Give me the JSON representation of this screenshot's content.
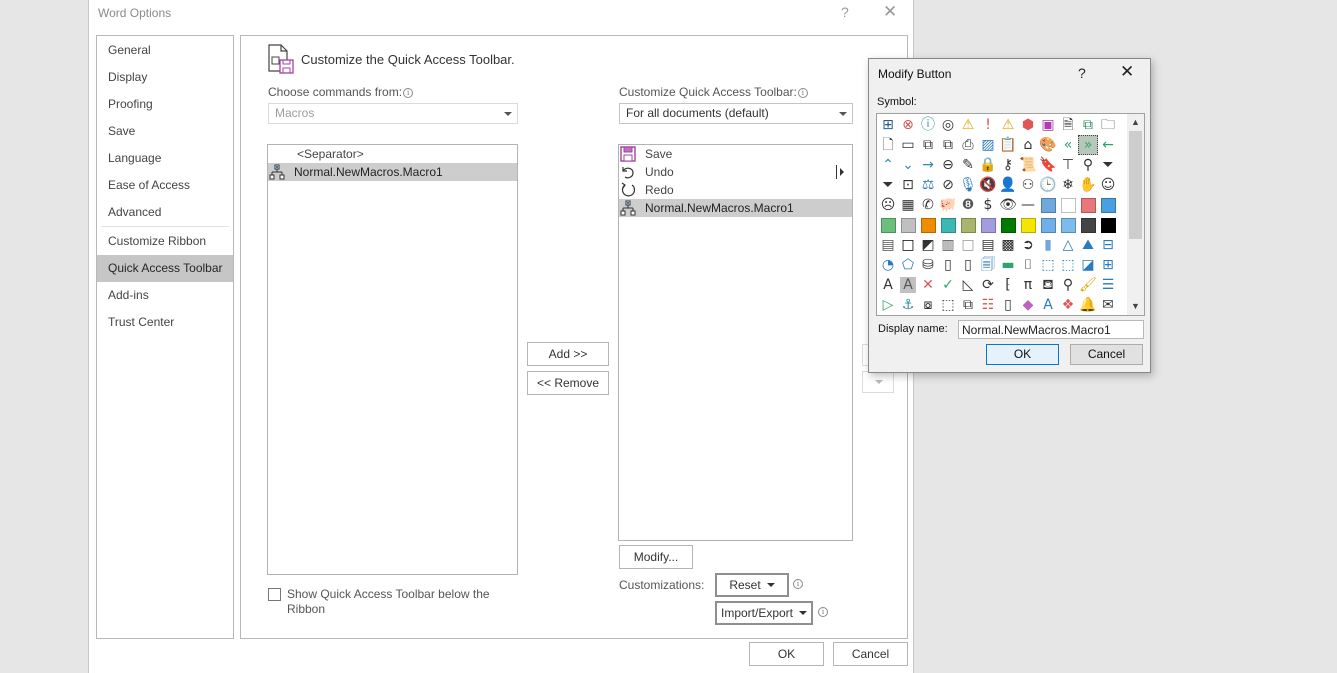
{
  "window": {
    "title": "Word Options",
    "help_label": "?",
    "close_label": "✕"
  },
  "nav": {
    "items": [
      {
        "label": "General"
      },
      {
        "label": "Display"
      },
      {
        "label": "Proofing"
      },
      {
        "label": "Save"
      },
      {
        "label": "Language"
      },
      {
        "label": "Ease of Access"
      },
      {
        "label": "Advanced"
      },
      {
        "label": "Customize Ribbon"
      },
      {
        "label": "Quick Access Toolbar",
        "active": true
      },
      {
        "label": "Add-ins"
      },
      {
        "label": "Trust Center"
      }
    ]
  },
  "main": {
    "heading": "Customize the Quick Access Toolbar.",
    "choose_label": "Choose commands from:",
    "choose_value": "Macros",
    "commands_list": [
      {
        "label": "<Separator>",
        "icon": "separator"
      },
      {
        "label": "Normal.NewMacros.Macro1",
        "icon": "macro-icon",
        "selected": true
      }
    ],
    "customize_label": "Customize Quick Access Toolbar:",
    "customize_value": "For all documents (default)",
    "toolbar_list": [
      {
        "label": "Save",
        "icon": "save-icon"
      },
      {
        "label": "Undo",
        "icon": "undo-icon"
      },
      {
        "label": "Redo",
        "icon": "redo-icon"
      },
      {
        "label": "Normal.NewMacros.Macro1",
        "icon": "macro-icon",
        "selected": true
      }
    ],
    "add_button": "Add >>",
    "remove_button": "<< Remove",
    "modify_button": "Modify...",
    "customizations_label": "Customizations:",
    "reset_button": "Reset",
    "import_export_button": "Import/Export",
    "show_below_ribbon_label": "Show Quick Access Toolbar below the Ribbon",
    "show_below_ribbon_checked": false,
    "ok_button": "OK",
    "cancel_button": "Cancel"
  },
  "modify_dialog": {
    "title": "Modify Button",
    "help_label": "?",
    "close_label": "✕",
    "symbol_label": "Symbol:",
    "display_name_label": "Display name:",
    "display_name_value": "Normal.NewMacros.Macro1",
    "ok_button": "OK",
    "cancel_button": "Cancel",
    "scroll_up": "▲",
    "scroll_down": "▼",
    "symbols": [
      {
        "name": "org-chart-icon",
        "glyph": "⊞",
        "color": "#2a5c8a"
      },
      {
        "name": "error-circle-icon",
        "glyph": "⊗",
        "color": "#d9534f"
      },
      {
        "name": "info-circle-icon",
        "glyph": "ⓘ",
        "color": "#2e8fa3"
      },
      {
        "name": "target-icon",
        "glyph": "◎",
        "color": "#333333"
      },
      {
        "name": "warning-icon",
        "glyph": "⚠",
        "color": "#e0a400"
      },
      {
        "name": "exclamation-icon",
        "glyph": "!",
        "color": "#d9534f"
      },
      {
        "name": "warning-alt-icon",
        "glyph": "⚠",
        "color": "#e0a400"
      },
      {
        "name": "shield-icon",
        "glyph": "⬢",
        "color": "#e05555"
      },
      {
        "name": "save-icon",
        "glyph": "▣",
        "color": "#b03cb0"
      },
      {
        "name": "document-arrow-icon",
        "glyph": "🗎",
        "color": "#333333"
      },
      {
        "name": "save-sync-icon",
        "glyph": "⧉",
        "color": "#2a8a5a"
      },
      {
        "name": "folder-icon",
        "glyph": "🗀",
        "color": "#333333"
      },
      {
        "name": "document-icon",
        "glyph": "🗋",
        "color": "#333333"
      },
      {
        "name": "folder-open-icon",
        "glyph": "▭",
        "color": "#333333"
      },
      {
        "name": "copy-icon",
        "glyph": "⧉",
        "color": "#333333"
      },
      {
        "name": "mail-merge-icon",
        "glyph": "⧉",
        "color": "#333333"
      },
      {
        "name": "printer-icon",
        "glyph": "⎙",
        "color": "#333333"
      },
      {
        "name": "picture-icon",
        "glyph": "▨",
        "color": "#2a7abf"
      },
      {
        "name": "clipboard-icon",
        "glyph": "📋",
        "color": "#333333"
      },
      {
        "name": "home-icon",
        "glyph": "⌂",
        "color": "#333333"
      },
      {
        "name": "palette-icon",
        "glyph": "🎨",
        "color": "#333333"
      },
      {
        "name": "double-left-arrow-icon",
        "glyph": "«",
        "color": "#2fa36b"
      },
      {
        "name": "double-right-arrow-icon",
        "glyph": "»",
        "color": "#2fa36b",
        "selected": true
      },
      {
        "name": "left-arrow-icon",
        "glyph": "←",
        "color": "#2fa36b"
      },
      {
        "name": "chevron-up-icon",
        "glyph": "⌃",
        "color": "#2e8fa3"
      },
      {
        "name": "chevron-down-icon",
        "glyph": "⌄",
        "color": "#2e8fa3"
      },
      {
        "name": "right-arrow-icon",
        "glyph": "→",
        "color": "#2e8fa3"
      },
      {
        "name": "back-circle-icon",
        "glyph": "⊖",
        "color": "#333333"
      },
      {
        "name": "pin-icon",
        "glyph": "✎",
        "color": "#333333"
      },
      {
        "name": "lock-icon",
        "glyph": "🔒",
        "color": "#333333"
      },
      {
        "name": "key-icon",
        "glyph": "⚷",
        "color": "#333333"
      },
      {
        "name": "scroll-icon",
        "glyph": "📜",
        "color": "#333333"
      },
      {
        "name": "bookmark-icon",
        "glyph": "🔖",
        "color": "#333333"
      },
      {
        "name": "presentation-icon",
        "glyph": "⊤",
        "color": "#333333"
      },
      {
        "name": "search-icon",
        "glyph": "⚲",
        "color": "#333333"
      },
      {
        "name": "filter-icon",
        "glyph": "⏷",
        "color": "#333333"
      },
      {
        "name": "funnel-icon",
        "glyph": "⏷",
        "color": "#333333"
      },
      {
        "name": "contact-card-icon",
        "glyph": "⊡",
        "color": "#333333"
      },
      {
        "name": "scales-icon",
        "glyph": "⚖",
        "color": "#2a7abf"
      },
      {
        "name": "no-entry-icon",
        "glyph": "⊘",
        "color": "#333333"
      },
      {
        "name": "microphone-icon",
        "glyph": "🎙",
        "color": "#2a7abf"
      },
      {
        "name": "mute-icon",
        "glyph": "🔇",
        "color": "#333333"
      },
      {
        "name": "user-filled-icon",
        "glyph": "👤",
        "color": "#333333"
      },
      {
        "name": "user-outline-icon",
        "glyph": "⚇",
        "color": "#333333"
      },
      {
        "name": "clock-icon",
        "glyph": "🕒",
        "color": "#333333"
      },
      {
        "name": "snowflake-icon",
        "glyph": "❄",
        "color": "#333333"
      },
      {
        "name": "hand-icon",
        "glyph": "✋",
        "color": "#333333"
      },
      {
        "name": "smile-icon",
        "glyph": "☺",
        "color": "#333333"
      },
      {
        "name": "sad-face-icon",
        "glyph": "☹",
        "color": "#333333"
      },
      {
        "name": "calculator-icon",
        "glyph": "▦",
        "color": "#333333"
      },
      {
        "name": "phone-icon",
        "glyph": "✆",
        "color": "#333333"
      },
      {
        "name": "piggy-bank-icon",
        "glyph": "🐖",
        "color": "#333333"
      },
      {
        "name": "eight-ball-icon",
        "glyph": "❽",
        "color": "#555555"
      },
      {
        "name": "dollar-quote-icon",
        "glyph": "$",
        "color": "#333333"
      },
      {
        "name": "eye-icon",
        "glyph": "👁",
        "color": "#333333"
      },
      {
        "name": "dash-icon",
        "glyph": "—",
        "color": "#333333"
      },
      {
        "name": "color-grid-icon",
        "swatch": "#6fa8dc"
      },
      {
        "name": "swatch-white",
        "swatch": "#ffffff"
      },
      {
        "name": "swatch-red",
        "swatch": "#e8777a"
      },
      {
        "name": "swatch-blue",
        "swatch": "#4a9fe0"
      },
      {
        "name": "swatch-green",
        "swatch": "#6abf7b"
      },
      {
        "name": "swatch-gray",
        "swatch": "#c0c0c0"
      },
      {
        "name": "swatch-orange",
        "swatch": "#f08c00"
      },
      {
        "name": "swatch-teal",
        "swatch": "#3cb7b4"
      },
      {
        "name": "swatch-olive",
        "swatch": "#a8b56b"
      },
      {
        "name": "swatch-lavender",
        "swatch": "#a39de0"
      },
      {
        "name": "swatch-dark-green",
        "swatch": "#007a00"
      },
      {
        "name": "swatch-yellow",
        "swatch": "#f5e600"
      },
      {
        "name": "swatch-light-blue",
        "swatch": "#6fb0ea"
      },
      {
        "name": "swatch-sky-blue",
        "swatch": "#7bbcec"
      },
      {
        "name": "swatch-black-white",
        "swatch": "#444444"
      },
      {
        "name": "swatch-black",
        "swatch": "#000000"
      },
      {
        "name": "gradient-icon",
        "glyph": "▤",
        "color": "#555555"
      },
      {
        "name": "square-outline-icon",
        "glyph": "□",
        "color": "#000000"
      },
      {
        "name": "diagonal-square-icon",
        "glyph": "◩",
        "color": "#333333"
      },
      {
        "name": "gradient-dark-icon",
        "glyph": "▥",
        "color": "#555555"
      },
      {
        "name": "square-light-icon",
        "glyph": "□",
        "color": "#999999"
      },
      {
        "name": "bars-dark-icon",
        "glyph": "▤",
        "color": "#333333"
      },
      {
        "name": "checker-icon",
        "glyph": "▩",
        "color": "#222222"
      },
      {
        "name": "arrow-circle-icon",
        "glyph": "➲",
        "color": "#333333"
      },
      {
        "name": "bar-chart-icon",
        "glyph": "▮",
        "color": "#6fa8dc"
      },
      {
        "name": "cone-icon",
        "glyph": "△",
        "color": "#2a7abf"
      },
      {
        "name": "mountains-icon",
        "glyph": "⛰",
        "color": "#2a7abf"
      },
      {
        "name": "align-left-icon",
        "glyph": "⊟",
        "color": "#2a7abf"
      },
      {
        "name": "pie-chart-icon",
        "glyph": "◔",
        "color": "#2a7abf"
      },
      {
        "name": "pentagon-icon",
        "glyph": "⬠",
        "color": "#2a7abf"
      },
      {
        "name": "database-icon",
        "glyph": "⛁",
        "color": "#333333"
      },
      {
        "name": "page-icon",
        "glyph": "▯",
        "color": "#333333"
      },
      {
        "name": "page-dots-icon",
        "glyph": "▯",
        "color": "#333333"
      },
      {
        "name": "page-globe-icon",
        "glyph": "🗐",
        "color": "#2a7abf"
      },
      {
        "name": "landscape-icon",
        "glyph": "▬",
        "color": "#2fa36b"
      },
      {
        "name": "bracket-page-icon",
        "glyph": "⌷",
        "color": "#333333"
      },
      {
        "name": "dashed-globe-icon",
        "glyph": "⬚",
        "color": "#2a7abf"
      },
      {
        "name": "dashed-globe-alt-icon",
        "glyph": "⬚",
        "color": "#2a7abf"
      },
      {
        "name": "diagonal-split-icon",
        "glyph": "◪",
        "color": "#2a7abf"
      },
      {
        "name": "hierarchy-icon",
        "glyph": "⊞",
        "color": "#2a7abf"
      },
      {
        "name": "text-box-icon",
        "glyph": "A",
        "color": "#333333"
      },
      {
        "name": "text-box-shaded-icon",
        "glyph": "A",
        "color": "#555555",
        "bg": "#c0c0c0"
      },
      {
        "name": "cross-icon",
        "glyph": "✕",
        "color": "#e05555"
      },
      {
        "name": "check-icon",
        "glyph": "✓",
        "color": "#2fa36b"
      },
      {
        "name": "ruler-triangle-icon",
        "glyph": "◺",
        "color": "#333333"
      },
      {
        "name": "refresh-icon",
        "glyph": "⟳",
        "color": "#333333"
      },
      {
        "name": "binary-icon",
        "glyph": "⁅",
        "color": "#333333"
      },
      {
        "name": "pi-icon",
        "glyph": "π",
        "color": "#333333"
      },
      {
        "name": "paint-bucket-icon",
        "glyph": "⛾",
        "color": "#333333"
      },
      {
        "name": "magnifier-icon",
        "glyph": "⚲",
        "color": "#333333"
      },
      {
        "name": "brush-icon",
        "glyph": "🖌",
        "color": "#e0a400"
      },
      {
        "name": "bullet-list-icon",
        "glyph": "☰",
        "color": "#2a7abf"
      },
      {
        "name": "play-icon",
        "glyph": "▷",
        "color": "#2fa36b"
      },
      {
        "name": "anchor-icon",
        "glyph": "⚓",
        "color": "#2e8fa3"
      },
      {
        "name": "toolbox-icon",
        "glyph": "⧇",
        "color": "#333333"
      },
      {
        "name": "dashed-add-icon",
        "glyph": "⬚",
        "color": "#333333"
      },
      {
        "name": "shapes-icon",
        "glyph": "⧉",
        "color": "#333333"
      },
      {
        "name": "list-alert-icon",
        "glyph": "☷",
        "color": "#d9534f"
      },
      {
        "name": "notebook-icon",
        "glyph": "▯",
        "color": "#333333"
      },
      {
        "name": "eraser-icon",
        "glyph": "◆",
        "color": "#c060c0"
      },
      {
        "name": "ink-icon",
        "glyph": "A",
        "color": "#2a7abf"
      },
      {
        "name": "office-logo-icon",
        "glyph": "❖",
        "color": "#e05555"
      },
      {
        "name": "bell-icon",
        "glyph": "🔔",
        "color": "#333333"
      },
      {
        "name": "envelope-open-icon",
        "glyph": "✉",
        "color": "#333333"
      }
    ]
  }
}
